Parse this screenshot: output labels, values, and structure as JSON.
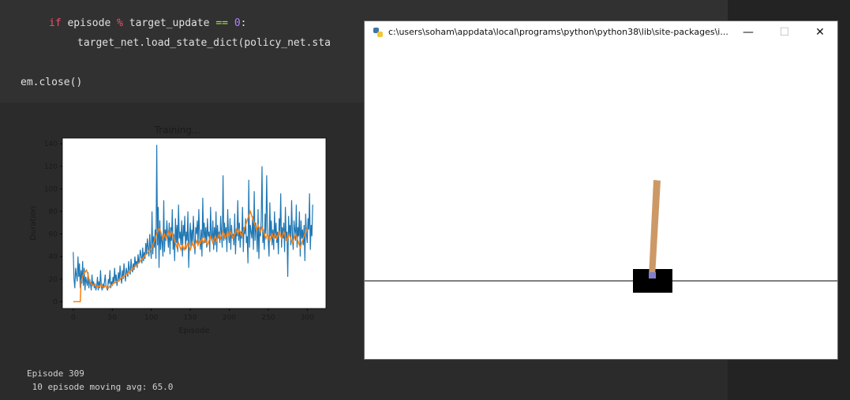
{
  "code": {
    "line1_kw": "if",
    "line1_a": " episode ",
    "line1_op": "%",
    "line1_b": " target_update ",
    "line1_eq": "==",
    "line1_num": "0",
    "line1_colon": ":",
    "line2": "target_net.load_state_dict(policy_net.sta",
    "line3": "em.close()"
  },
  "output": {
    "episode_line": "Episode 309",
    "avg_line": " 10 episode moving avg: 65.0"
  },
  "window": {
    "title": "c:\\users\\soham\\appdata\\local\\programs\\python\\python38\\lib\\site-packages\\i...",
    "minimize": "—",
    "maximize": "☐",
    "close": "✕"
  },
  "chart_data": {
    "type": "line",
    "title": "Training...",
    "xlabel": "Episode",
    "ylabel": "Duration",
    "xlim": [
      -14,
      324
    ],
    "ylim": [
      -6,
      145
    ],
    "xticks": [
      0,
      50,
      100,
      150,
      200,
      250,
      300
    ],
    "yticks": [
      0,
      20,
      40,
      60,
      80,
      100,
      120,
      140
    ],
    "series": [
      {
        "color": "#1f77b4",
        "values": [
          44,
          20,
          12,
          30,
          24,
          18,
          40,
          22,
          34,
          12,
          28,
          16,
          36,
          14,
          30,
          10,
          22,
          18,
          14,
          26,
          12,
          20,
          16,
          10,
          24,
          14,
          18,
          12,
          16,
          10,
          14,
          22,
          10,
          18,
          12,
          28,
          14,
          10,
          16,
          12,
          18,
          24,
          14,
          12,
          10,
          20,
          16,
          28,
          12,
          18,
          14,
          22,
          16,
          30,
          18,
          24,
          14,
          20,
          26,
          18,
          32,
          22,
          16,
          28,
          20,
          34,
          24,
          18,
          30,
          26,
          22,
          36,
          28,
          24,
          38,
          30,
          26,
          34,
          28,
          40,
          32,
          36,
          30,
          42,
          34,
          38,
          46,
          40,
          34,
          48,
          36,
          44,
          38,
          52,
          42,
          56,
          48,
          40,
          60,
          46,
          38,
          80,
          42,
          58,
          48,
          64,
          38,
          139,
          50,
          84,
          30,
          72,
          46,
          60,
          52,
          40,
          90,
          44,
          64,
          54,
          72,
          58,
          48,
          70,
          42,
          66,
          54,
          82,
          46,
          60,
          36,
          74,
          52,
          68,
          44,
          86,
          56,
          62,
          50,
          72,
          40,
          68,
          58,
          76,
          46,
          62,
          54,
          80,
          30,
          58,
          70,
          48,
          64,
          52,
          76,
          56,
          42,
          66,
          60,
          72,
          50,
          82,
          58,
          46,
          64,
          40,
          92,
          56,
          70,
          52,
          66,
          48,
          74,
          58,
          62,
          44,
          84,
          60,
          54,
          72,
          46,
          66,
          50,
          80,
          44,
          68,
          56,
          62,
          52,
          76,
          60,
          48,
          112,
          54,
          70,
          58,
          66,
          44,
          82,
          60,
          52,
          74,
          46,
          68,
          56,
          60,
          50,
          78,
          42,
          64,
          58,
          90,
          54,
          70,
          48,
          62,
          56,
          84,
          44,
          66,
          60,
          74,
          52,
          58,
          34,
          108,
          48,
          68,
          62,
          56,
          76,
          46,
          98,
          54,
          70,
          60,
          44,
          82,
          38,
          66,
          58,
          72,
          120,
          52,
          64,
          46,
          78,
          60,
          112,
          66,
          54,
          40,
          88,
          58,
          72,
          50,
          64,
          46,
          80,
          56,
          70,
          52,
          62,
          42,
          74,
          60,
          96,
          48,
          66,
          56,
          70,
          44,
          84,
          54,
          62,
          22,
          76,
          58,
          68,
          50,
          90,
          60,
          46,
          72,
          64,
          54,
          86,
          48,
          66,
          58,
          80,
          40,
          72,
          56,
          64,
          50,
          68,
          36,
          78,
          60,
          52,
          74,
          64,
          96,
          46,
          68,
          58,
          86
        ]
      },
      {
        "color": "#ff7f0e",
        "values": [
          0,
          0,
          0,
          0,
          0,
          0,
          0,
          0,
          0,
          0,
          18,
          20,
          22,
          24,
          26,
          26,
          27,
          28,
          26,
          24,
          20,
          18,
          17,
          16,
          15,
          15,
          15,
          15,
          14,
          14,
          13,
          14,
          14,
          13,
          14,
          15,
          14,
          14,
          13,
          13,
          13,
          14,
          14,
          13,
          12,
          12,
          13,
          14,
          14,
          15,
          15,
          16,
          16,
          17,
          17,
          18,
          18,
          18,
          19,
          19,
          20,
          21,
          21,
          22,
          22,
          23,
          23,
          24,
          24,
          25,
          25,
          26,
          26,
          27,
          28,
          28,
          29,
          30,
          30,
          31,
          32,
          32,
          33,
          34,
          34,
          35,
          36,
          37,
          38,
          38,
          39,
          40,
          41,
          42,
          42,
          43,
          44,
          45,
          46,
          46,
          47,
          48,
          50,
          52,
          54,
          56,
          58,
          60,
          62,
          64,
          65,
          64,
          62,
          60,
          58,
          56,
          58,
          60,
          58,
          56,
          58,
          60,
          62,
          60,
          58,
          60,
          62,
          60,
          58,
          56,
          54,
          52,
          50,
          48,
          50,
          52,
          50,
          48,
          46,
          48,
          50,
          48,
          46,
          48,
          50,
          48,
          50,
          52,
          50,
          48,
          46,
          48,
          50,
          52,
          50,
          48,
          50,
          52,
          54,
          52,
          50,
          52,
          54,
          52,
          54,
          56,
          54,
          52,
          54,
          56,
          54,
          52,
          50,
          52,
          54,
          56,
          58,
          56,
          54,
          52,
          54,
          56,
          58,
          56,
          54,
          56,
          58,
          60,
          58,
          56,
          58,
          60,
          62,
          60,
          58,
          56,
          58,
          60,
          62,
          60,
          58,
          60,
          62,
          60,
          58,
          56,
          58,
          60,
          62,
          64,
          62,
          60,
          62,
          64,
          62,
          60,
          58,
          60,
          62,
          64,
          66,
          68,
          70,
          72,
          74,
          76,
          78,
          80,
          78,
          76,
          74,
          72,
          70,
          68,
          66,
          64,
          66,
          68,
          66,
          64,
          62,
          64,
          66,
          64,
          62,
          60,
          58,
          56,
          58,
          60,
          58,
          56,
          54,
          56,
          58,
          60,
          58,
          56,
          58,
          60,
          58,
          56,
          58,
          60,
          62,
          60,
          58,
          56,
          58,
          60,
          62,
          60,
          58,
          56,
          54,
          56,
          58,
          60,
          58,
          56,
          54,
          52,
          54,
          56,
          58,
          60,
          58,
          56,
          54,
          52,
          50,
          48,
          50,
          52,
          54,
          56,
          58,
          60,
          62,
          64,
          65
        ]
      }
    ]
  },
  "colors": {
    "notebook_bg": "#2b2b2b",
    "code_cell_bg": "#313131",
    "pole": "#cc9966",
    "cart": "#000000",
    "axle": "#8080cc"
  }
}
